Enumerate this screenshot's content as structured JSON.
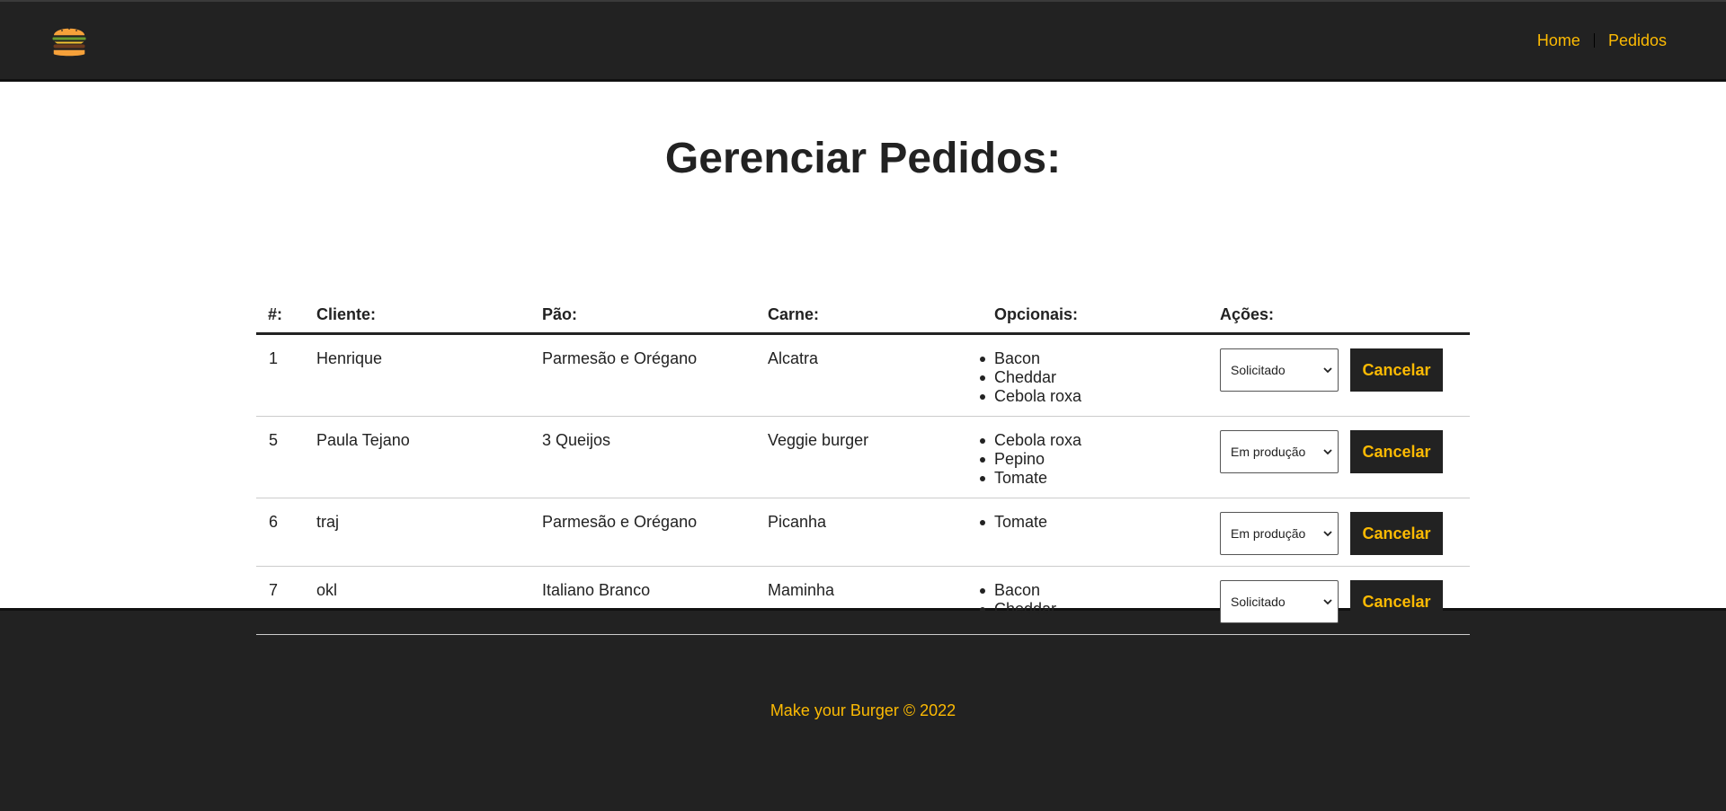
{
  "nav": {
    "logo_icon": "burger-icon",
    "links": [
      "Home",
      "Pedidos"
    ]
  },
  "page_title": "Gerenciar Pedidos:",
  "table": {
    "headers": [
      "#:",
      "Cliente:",
      "Pão:",
      "Carne:",
      "Opcionais:",
      "Ações:"
    ],
    "rows": [
      {
        "id": "1",
        "client": "Henrique",
        "bread": "Parmesão e Orégano",
        "meat": "Alcatra",
        "optionals": [
          "Bacon",
          "Cheddar",
          "Cebola roxa"
        ],
        "status": "Solicitado",
        "action": "Cancelar"
      },
      {
        "id": "5",
        "client": "Paula Tejano",
        "bread": "3 Queijos",
        "meat": "Veggie burger",
        "optionals": [
          "Cebola roxa",
          "Pepino",
          "Tomate"
        ],
        "status": "Em produção",
        "action": "Cancelar"
      },
      {
        "id": "6",
        "client": "traj",
        "bread": "Parmesão e Orégano",
        "meat": "Picanha",
        "optionals": [
          "Tomate"
        ],
        "status": "Em produção",
        "action": "Cancelar"
      },
      {
        "id": "7",
        "client": "okl",
        "bread": "Italiano Branco",
        "meat": "Maminha",
        "optionals": [
          "Bacon",
          "Cheddar"
        ],
        "status": "Solicitado",
        "action": "Cancelar"
      }
    ]
  },
  "footer": {
    "text": "Make your Burger © 2022"
  },
  "colors": {
    "dark": "#222222",
    "accent": "#fcba03",
    "white": "#ffffff"
  }
}
